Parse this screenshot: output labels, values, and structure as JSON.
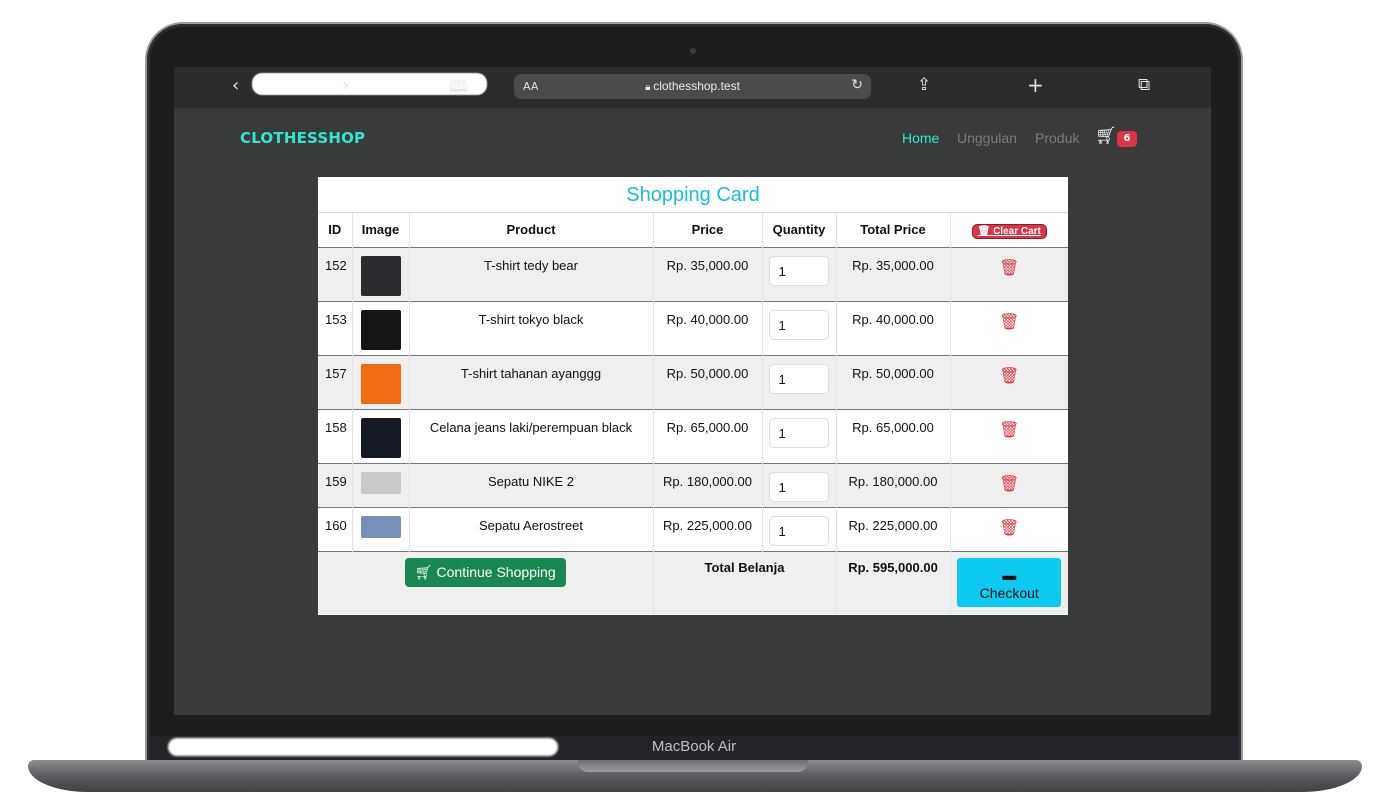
{
  "device": {
    "label": "MacBook Air"
  },
  "browser": {
    "text_size_label": "AA",
    "url": "clothesshop.test"
  },
  "site": {
    "logo": "CLOTHESSHOP",
    "nav": [
      "Home",
      "Unggulan",
      "Produk"
    ],
    "cart_count": "6"
  },
  "cart": {
    "title": "Shopping Card",
    "columns": [
      "ID",
      "Image",
      "Product",
      "Price",
      "Quantity",
      "Total Price"
    ],
    "clear_label": "Clear Cart",
    "rows": [
      {
        "id": "152",
        "product": "T-shirt tedy bear",
        "price": "Rp.  35,000.00",
        "qty": "1",
        "total": "Rp.  35,000.00",
        "thumb_color": "#2a2c30"
      },
      {
        "id": "153",
        "product": "T-shirt tokyo black",
        "price": "Rp.  40,000.00",
        "qty": "1",
        "total": "Rp.  40,000.00",
        "thumb_color": "#161616"
      },
      {
        "id": "157",
        "product": "T-shirt tahanan ayanggg",
        "price": "Rp.  50,000.00",
        "qty": "1",
        "total": "Rp.  50,000.00",
        "thumb_color": "#f26a12"
      },
      {
        "id": "158",
        "product": "Celana jeans laki/perempuan black",
        "price": "Rp.  65,000.00",
        "qty": "1",
        "total": "Rp.  65,000.00",
        "thumb_color": "#151a24"
      },
      {
        "id": "159",
        "product": "Sepatu NIKE 2",
        "price": "Rp.  180,000.00",
        "qty": "1",
        "total": "Rp.  180,000.00",
        "thumb_color": "#c9c9c9"
      },
      {
        "id": "160",
        "product": "Sepatu Aerostreet",
        "price": "Rp.  225,000.00",
        "qty": "1",
        "total": "Rp.  225,000.00",
        "thumb_color": "#7a8fb8"
      }
    ],
    "continue_label": "Continue Shopping",
    "total_label": "Total Belanja",
    "grand_total": "Rp.  595,000.00",
    "checkout_label": "Checkout"
  }
}
